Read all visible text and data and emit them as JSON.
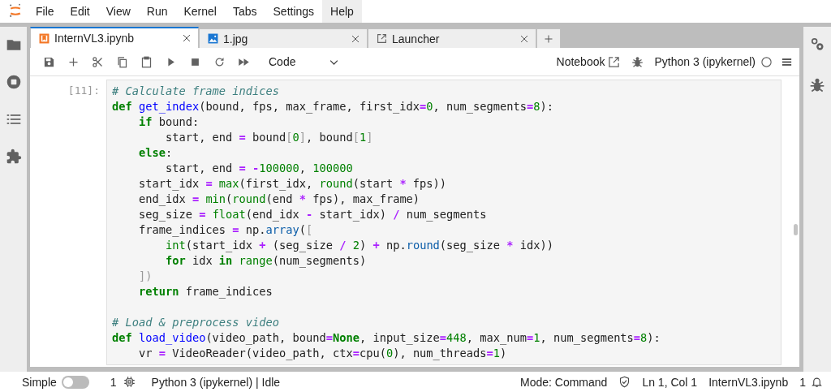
{
  "menu": [
    {
      "label": "File",
      "selected": false
    },
    {
      "label": "Edit",
      "selected": false
    },
    {
      "label": "View",
      "selected": false
    },
    {
      "label": "Run",
      "selected": false
    },
    {
      "label": "Kernel",
      "selected": false
    },
    {
      "label": "Tabs",
      "selected": false
    },
    {
      "label": "Settings",
      "selected": false
    },
    {
      "label": "Help",
      "selected": true
    }
  ],
  "left_sidebar": [
    {
      "kind": "folder",
      "selected": false
    },
    {
      "kind": "running",
      "selected": false
    },
    {
      "kind": "toc",
      "selected": false
    },
    {
      "kind": "extension",
      "selected": false
    }
  ],
  "right_sidebar": [
    {
      "kind": "property"
    },
    {
      "kind": "debugger"
    }
  ],
  "tabs": [
    {
      "label": "InternVL3.ipynb",
      "kind": "notebook",
      "selected": true
    },
    {
      "label": "1.jpg",
      "kind": "image",
      "selected": false
    },
    {
      "label": "Launcher",
      "kind": "launcher",
      "selected": false
    }
  ],
  "toolbar": {
    "buttons": [
      {
        "kind": "save"
      },
      {
        "kind": "insert"
      },
      {
        "kind": "cut"
      },
      {
        "kind": "copy"
      },
      {
        "kind": "paste"
      },
      {
        "kind": "run"
      },
      {
        "kind": "stop"
      },
      {
        "kind": "restart"
      },
      {
        "kind": "run-all"
      }
    ],
    "cell_type": "Code",
    "notebook_label": "Notebook",
    "kernel": "Python 3 (ipykernel)",
    "kernel_busy": false
  },
  "cell": {
    "prompt": "[11]:",
    "lines": [
      {
        "tokens": [
          {
            "kind": "comment",
            "text": "# Calculate frame indices"
          }
        ]
      },
      {
        "tokens": [
          {
            "kind": "keyword",
            "text": "def "
          },
          {
            "kind": "name",
            "text": "get_index"
          },
          {
            "kind": "plain",
            "text": "(bound, fps, max_frame, first_idx"
          },
          {
            "kind": "operator",
            "text": "="
          },
          {
            "kind": "number",
            "text": "0"
          },
          {
            "kind": "plain",
            "text": ", num_segments"
          },
          {
            "kind": "operator",
            "text": "="
          },
          {
            "kind": "number",
            "text": "8"
          },
          {
            "kind": "plain",
            "text": "):"
          }
        ]
      },
      {
        "tokens": [
          {
            "kind": "keyword",
            "text": "    if"
          },
          {
            "kind": "plain",
            "text": " bound:"
          }
        ]
      },
      {
        "tokens": [
          {
            "kind": "plain",
            "text": "        start, end "
          },
          {
            "kind": "operator",
            "text": "="
          },
          {
            "kind": "plain",
            "text": " bound"
          },
          {
            "kind": "bracket",
            "text": "["
          },
          {
            "kind": "number",
            "text": "0"
          },
          {
            "kind": "bracket",
            "text": "]"
          },
          {
            "kind": "plain",
            "text": ", bound"
          },
          {
            "kind": "bracket",
            "text": "["
          },
          {
            "kind": "number",
            "text": "1"
          },
          {
            "kind": "bracket",
            "text": "]"
          }
        ]
      },
      {
        "tokens": [
          {
            "kind": "keyword",
            "text": "    else"
          },
          {
            "kind": "plain",
            "text": ":"
          }
        ]
      },
      {
        "tokens": [
          {
            "kind": "plain",
            "text": "        start, end "
          },
          {
            "kind": "operator",
            "text": "= -"
          },
          {
            "kind": "number",
            "text": "100000"
          },
          {
            "kind": "plain",
            "text": ", "
          },
          {
            "kind": "number",
            "text": "100000"
          }
        ]
      },
      {
        "tokens": [
          {
            "kind": "plain",
            "text": "    start_idx "
          },
          {
            "kind": "operator",
            "text": "="
          },
          {
            "kind": "builtin",
            "text": " max"
          },
          {
            "kind": "plain",
            "text": "(first_idx, "
          },
          {
            "kind": "builtin",
            "text": "round"
          },
          {
            "kind": "plain",
            "text": "(start "
          },
          {
            "kind": "operator",
            "text": "*"
          },
          {
            "kind": "plain",
            "text": " fps))"
          }
        ]
      },
      {
        "tokens": [
          {
            "kind": "plain",
            "text": "    end_idx "
          },
          {
            "kind": "operator",
            "text": "="
          },
          {
            "kind": "builtin",
            "text": " min"
          },
          {
            "kind": "plain",
            "text": "("
          },
          {
            "kind": "builtin",
            "text": "round"
          },
          {
            "kind": "plain",
            "text": "(end "
          },
          {
            "kind": "operator",
            "text": "*"
          },
          {
            "kind": "plain",
            "text": " fps), max_frame)"
          }
        ]
      },
      {
        "tokens": [
          {
            "kind": "plain",
            "text": "    seg_size "
          },
          {
            "kind": "operator",
            "text": "="
          },
          {
            "kind": "builtin",
            "text": " float"
          },
          {
            "kind": "plain",
            "text": "(end_idx "
          },
          {
            "kind": "operator",
            "text": "-"
          },
          {
            "kind": "plain",
            "text": " start_idx) "
          },
          {
            "kind": "operator",
            "text": "/"
          },
          {
            "kind": "plain",
            "text": " num_segments"
          }
        ]
      },
      {
        "tokens": [
          {
            "kind": "plain",
            "text": "    frame_indices "
          },
          {
            "kind": "operator",
            "text": "="
          },
          {
            "kind": "plain",
            "text": " np."
          },
          {
            "kind": "attribute",
            "text": "array"
          },
          {
            "kind": "plain",
            "text": "("
          },
          {
            "kind": "bracket",
            "text": "["
          }
        ]
      },
      {
        "tokens": [
          {
            "kind": "builtin",
            "text": "        int"
          },
          {
            "kind": "plain",
            "text": "(start_idx "
          },
          {
            "kind": "operator",
            "text": "+"
          },
          {
            "kind": "plain",
            "text": " (seg_size "
          },
          {
            "kind": "operator",
            "text": "/"
          },
          {
            "kind": "number",
            "text": " 2"
          },
          {
            "kind": "plain",
            "text": ") "
          },
          {
            "kind": "operator",
            "text": "+"
          },
          {
            "kind": "plain",
            "text": " np."
          },
          {
            "kind": "attribute",
            "text": "round"
          },
          {
            "kind": "plain",
            "text": "(seg_size "
          },
          {
            "kind": "operator",
            "text": "*"
          },
          {
            "kind": "plain",
            "text": " idx))"
          }
        ]
      },
      {
        "tokens": [
          {
            "kind": "keyword",
            "text": "        for"
          },
          {
            "kind": "plain",
            "text": " idx "
          },
          {
            "kind": "keyword",
            "text": "in"
          },
          {
            "kind": "builtin",
            "text": " range"
          },
          {
            "kind": "plain",
            "text": "(num_segments)"
          }
        ]
      },
      {
        "tokens": [
          {
            "kind": "bracket",
            "text": "    ])"
          }
        ]
      },
      {
        "tokens": [
          {
            "kind": "keyword",
            "text": "    return"
          },
          {
            "kind": "plain",
            "text": " frame_indices"
          }
        ]
      },
      {
        "spacer_before": true,
        "tokens": [
          {
            "kind": "comment",
            "text": "# Load & preprocess video"
          }
        ]
      },
      {
        "tokens": [
          {
            "kind": "keyword",
            "text": "def "
          },
          {
            "kind": "name",
            "text": "load_video"
          },
          {
            "kind": "plain",
            "text": "(video_path, bound"
          },
          {
            "kind": "operator",
            "text": "="
          },
          {
            "kind": "keyword",
            "text": "None"
          },
          {
            "kind": "plain",
            "text": ", input_size"
          },
          {
            "kind": "operator",
            "text": "="
          },
          {
            "kind": "number",
            "text": "448"
          },
          {
            "kind": "plain",
            "text": ", max_num"
          },
          {
            "kind": "operator",
            "text": "="
          },
          {
            "kind": "number",
            "text": "1"
          },
          {
            "kind": "plain",
            "text": ", num_segments"
          },
          {
            "kind": "operator",
            "text": "="
          },
          {
            "kind": "number",
            "text": "8"
          },
          {
            "kind": "plain",
            "text": "):"
          }
        ]
      },
      {
        "tokens": [
          {
            "kind": "plain",
            "text": "    vr "
          },
          {
            "kind": "operator",
            "text": "="
          },
          {
            "kind": "plain",
            "text": " VideoReader(video_path, ctx"
          },
          {
            "kind": "operator",
            "text": "="
          },
          {
            "kind": "plain",
            "text": "cpu("
          },
          {
            "kind": "number",
            "text": "0"
          },
          {
            "kind": "plain",
            "text": "), num_threads"
          },
          {
            "kind": "operator",
            "text": "="
          },
          {
            "kind": "number",
            "text": "1"
          },
          {
            "kind": "plain",
            "text": ")"
          }
        ]
      }
    ]
  },
  "status_bar": {
    "mode_label": "Simple",
    "simple_on": false,
    "terminals": "1",
    "kernel_status": "Python 3 (ipykernel) | Idle",
    "mode": "Mode: Command",
    "position": "Ln 1, Col 1",
    "file": "InternVL3.ipynb",
    "notifications": "1"
  }
}
